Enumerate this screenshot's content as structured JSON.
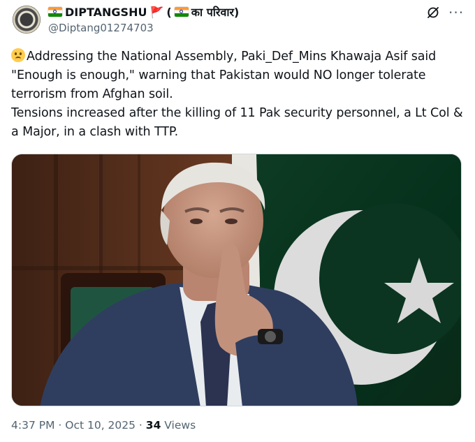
{
  "author": {
    "display_name": "DIPTANGSHU",
    "red_flag": "🚩",
    "family_tag_open": "(",
    "family_tag_text": "का परिवार)",
    "handle": "@Diptang01274703"
  },
  "tweet": {
    "line1": "Addressing the National Assembly, Paki_Def_Mins Khawaja Asif said \"Enough is enough,\" warning that Pakistan would NO longer tolerate terrorism from Afghan soil.",
    "line2": "Tensions increased after the killing of 11 Pak security personnel, a Lt Col & a Major, in a clash with TTP."
  },
  "meta": {
    "time": "4:37 PM",
    "separator": " · ",
    "date": "Oct 10, 2025",
    "views_count": "34",
    "views_label": " Views"
  },
  "colors": {
    "text": "#0f1419",
    "secondary": "#536471",
    "flag_green": "#01411c"
  },
  "icons": {
    "grok": "grok-icon",
    "more": "more-icon"
  }
}
